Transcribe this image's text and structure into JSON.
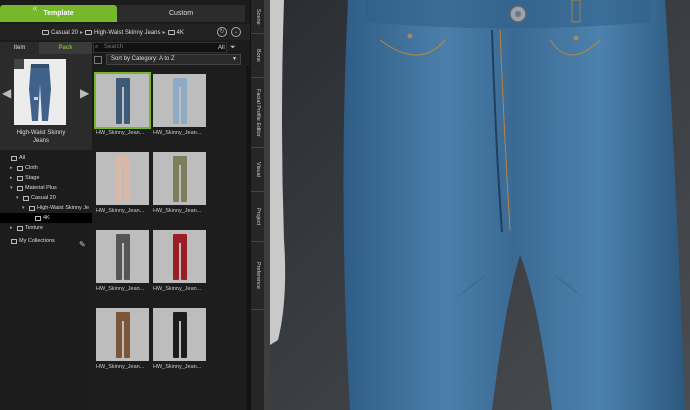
{
  "tabs": {
    "template": "Template",
    "custom": "Custom"
  },
  "breadcrumb": [
    "Casual 20",
    "High-Waist Skinny Jeans",
    "4K"
  ],
  "subtabs": {
    "item": "Item",
    "pack": "Pack"
  },
  "preview": {
    "label": "High-Waist Skinny Jeans"
  },
  "tree": [
    {
      "label": "All",
      "level": 0,
      "tri": ""
    },
    {
      "label": "Cloth",
      "level": 1,
      "tri": "▸"
    },
    {
      "label": "Stage",
      "level": 1,
      "tri": "▸"
    },
    {
      "label": "Material Plus",
      "level": 1,
      "tri": "▾"
    },
    {
      "label": "Casual 20",
      "level": 2,
      "tri": "▾"
    },
    {
      "label": "High-Waist Skinny Je",
      "level": 3,
      "tri": "▾"
    },
    {
      "label": "4K",
      "level": 4,
      "tri": "",
      "selected": true
    },
    {
      "label": "Texture",
      "level": 1,
      "tri": "▸"
    },
    {
      "label": "My Collections",
      "level": 0,
      "tri": ""
    }
  ],
  "search": {
    "placeholder": "Search",
    "filter": "All"
  },
  "sort": {
    "label": "Sort by Category: A to Z"
  },
  "items": [
    {
      "label": "HW_Skinny_Jean...",
      "color": "#3d5a78",
      "selected": true
    },
    {
      "label": "HW_Skinny_Jean...",
      "color": "#8faac4"
    },
    {
      "label": "HW_Skinny_Jean...",
      "color": "#d9b8a8"
    },
    {
      "label": "HW_Skinny_Jean...",
      "color": "#7e7d5a"
    },
    {
      "label": "HW_Skinny_Jean...",
      "color": "#555555"
    },
    {
      "label": "HW_Skinny_Jean...",
      "color": "#9c1e24"
    },
    {
      "label": "HW_Skinny_Jean...",
      "color": "#7a5538"
    },
    {
      "label": "HW_Skinny_Jean...",
      "color": "#1c1c1c"
    }
  ],
  "side_tabs": [
    "Scene",
    "Bone",
    "Facial Profile Editor",
    "Visual",
    "Project",
    "Preference"
  ],
  "colors": {
    "accent": "#76b82a",
    "denim": "#3b6e9a"
  }
}
